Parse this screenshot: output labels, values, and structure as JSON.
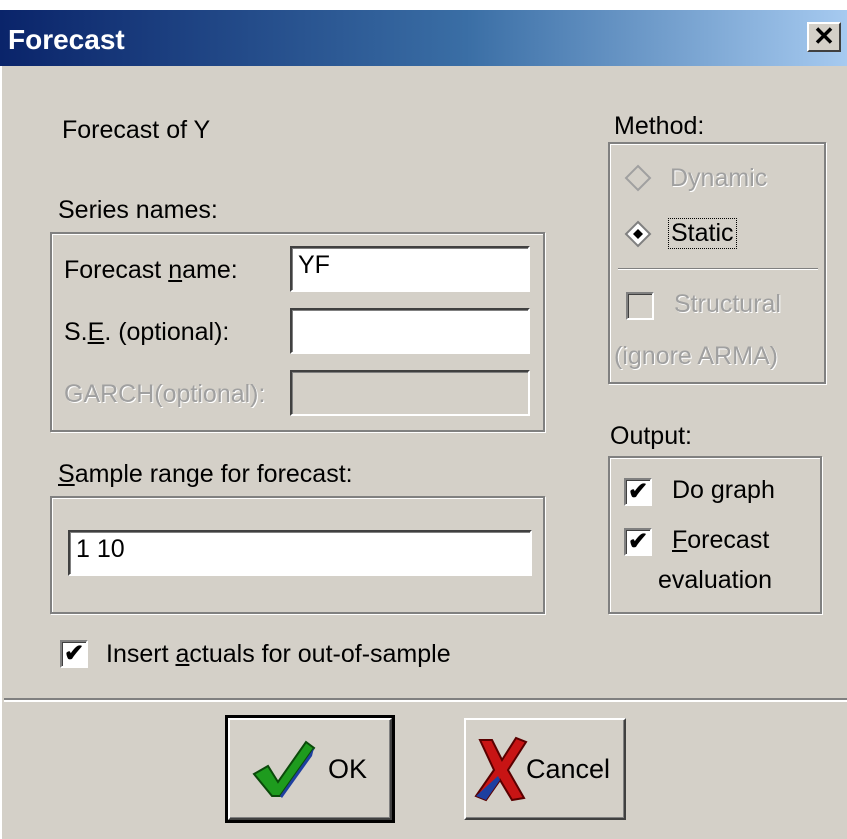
{
  "window": {
    "title": "Forecast",
    "close_glyph": "✕"
  },
  "heading": "Forecast of Y",
  "series_names": {
    "label": "Series names:",
    "forecast_name": {
      "label_before": "Forecast ",
      "label_ul": "n",
      "label_after": "ame:",
      "value": "YF"
    },
    "se": {
      "label_before": "S.",
      "label_ul": "E",
      "label_after": ". (optional):",
      "value": ""
    },
    "garch": {
      "label": "GARCH(optional):",
      "value": ""
    }
  },
  "sample_range": {
    "label_ul": "S",
    "label_after": "ample range for forecast:",
    "value": "1 10"
  },
  "insert_actuals": {
    "label_before": "Insert ",
    "label_ul": "a",
    "label_after": "ctuals for out-of-sample",
    "checked": true
  },
  "method": {
    "label": "Method:",
    "dynamic": {
      "label": "Dynamic",
      "selected": false,
      "enabled": false
    },
    "static": {
      "label": "Static",
      "selected": true,
      "enabled": true
    },
    "structural": {
      "label": "Structural",
      "sublabel": "(ignore ARMA)",
      "checked": false,
      "enabled": false
    }
  },
  "output": {
    "label": "Output:",
    "do_graph": {
      "label": "Do graph",
      "checked": true
    },
    "forecast_eval": {
      "label_ul": "F",
      "label_after": "orecast",
      "label2": "evaluation",
      "checked": true
    }
  },
  "buttons": {
    "ok": "OK",
    "cancel": "Cancel"
  },
  "check_glyph": "✔",
  "colors": {
    "title_gradient_start": "#0a246a",
    "title_gradient_end": "#a6caf0",
    "face": "#d4d0c8",
    "ok_check": "#1e9b1e",
    "cancel_x": "#c81414"
  }
}
